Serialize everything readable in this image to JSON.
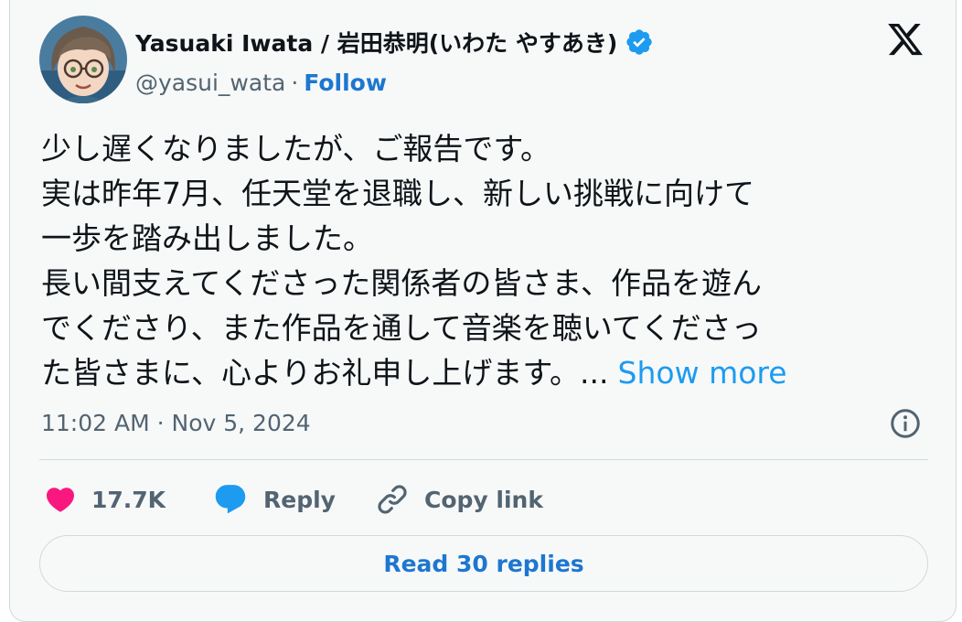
{
  "author": {
    "name": "Yasuaki Iwata / 岩田恭明(いわた やすあき)",
    "handle": "@yasui_wata",
    "separator": "·",
    "follow_label": "Follow",
    "verified_icon": "verified-badge-icon",
    "avatar": "illustrated-avatar"
  },
  "brand": {
    "logo_icon": "x-logo-icon"
  },
  "post": {
    "lines": [
      "少し遅くなりましたが、ご報告です。",
      "実は昨年7月、任天堂を退職し、新しい挑戦に向けて",
      "一歩を踏み出しました。",
      "長い間支えてくださった関係者の皆さま、作品を遊ん",
      "でくださり、また作品を通して音楽を聴いてくださっ",
      "た皆さまに、心よりお礼申し上げます。..."
    ],
    "show_more_label": "Show more",
    "timestamp": "11:02 AM · Nov 5, 2024"
  },
  "actions": {
    "likes": "17.7K",
    "reply_label": "Reply",
    "copy_link_label": "Copy link"
  },
  "replies_button_label": "Read 30 replies",
  "colors": {
    "like": "#f91880",
    "reply": "#1d9bf0",
    "link": "#1d77d0",
    "secondary_text": "#536471",
    "verified": "#1d9bf0"
  }
}
